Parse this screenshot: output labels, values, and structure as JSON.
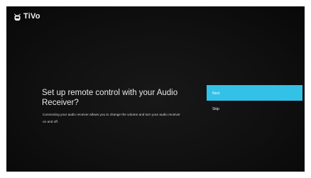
{
  "brand": {
    "name": "TiVo",
    "icon": "tivo-robot-icon"
  },
  "prompt": {
    "title": "Set up remote control with your Audio Receiver?",
    "description": "Connecting your audio receiver allows you to change the volume and turn your audio receiver on and off."
  },
  "options": [
    {
      "label": "Next",
      "selected": true
    },
    {
      "label": "Skip",
      "selected": false
    }
  ],
  "colors": {
    "background": "#0d0d0d",
    "selection_accent": "#33c1e8",
    "text": "#e9e9e9"
  }
}
